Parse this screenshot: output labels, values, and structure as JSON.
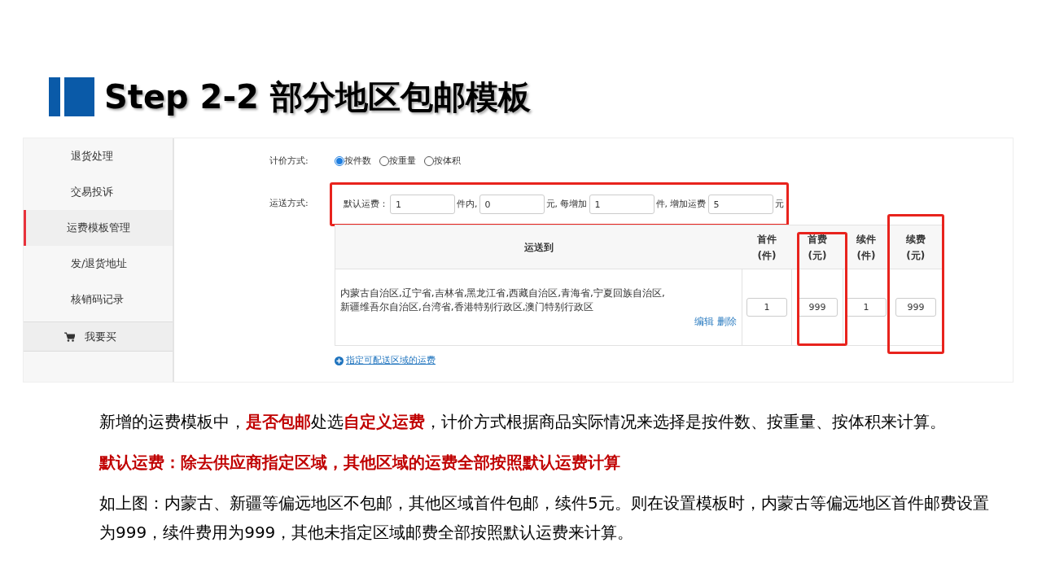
{
  "title": "Step 2-2 部分地区包邮模板",
  "sidebar": {
    "items": [
      {
        "label": "退货处理",
        "selected": false
      },
      {
        "label": "交易投诉",
        "selected": false
      },
      {
        "label": "运费模板管理",
        "selected": true
      },
      {
        "label": "发/退货地址",
        "selected": false
      },
      {
        "label": "核销码记录",
        "selected": false
      }
    ],
    "buy_button": "我要买"
  },
  "form": {
    "pricing_label": "计价方式:",
    "pricing_options": [
      {
        "label": "按件数",
        "selected": true
      },
      {
        "label": "按重量",
        "selected": false
      },
      {
        "label": "按体积",
        "selected": false
      }
    ],
    "shipping_label": "运送方式:",
    "default_fee": {
      "highlighted": true,
      "segments": [
        {
          "kind": "text",
          "text": "默认运费："
        },
        {
          "kind": "field",
          "value": "1"
        },
        {
          "kind": "text",
          "text": "件内,"
        },
        {
          "kind": "field",
          "value": "0"
        },
        {
          "kind": "text",
          "text": "元, 每增加"
        },
        {
          "kind": "field",
          "value": "1"
        },
        {
          "kind": "text",
          "text": "件, 增加运费"
        },
        {
          "kind": "field",
          "value": "5"
        },
        {
          "kind": "text",
          "text": "元"
        }
      ]
    }
  },
  "table": {
    "columns": [
      {
        "lines": [
          "运送到"
        ],
        "highlighted": false
      },
      {
        "lines": [
          "首件",
          "(件)"
        ],
        "highlighted": false
      },
      {
        "lines": [
          "首费",
          "(元)"
        ],
        "highlighted": true
      },
      {
        "lines": [
          "续件",
          "(件)"
        ],
        "highlighted": false
      },
      {
        "lines": [
          "续费",
          "(元)"
        ],
        "highlighted": true
      }
    ],
    "rows": [
      {
        "regions": "内蒙古自治区,辽宁省,吉林省,黑龙江省,西藏自治区,青海省,宁夏回族自治区,新疆维吾尔自治区,台湾省,香港特别行政区,澳门特别行政区",
        "actions": [
          "编辑",
          "删除"
        ],
        "values": [
          "1",
          "999",
          "1",
          "999"
        ]
      }
    ]
  },
  "add_link": "指定可配送区域的运费",
  "paragraphs": [
    {
      "kind": "normal",
      "text": "新增的运费模板中，**是否包邮**处选**自定义运费**，计价方式根据商品实际情况来选择是按件数、按重量、按体积来计算。"
    },
    {
      "kind": "emphasis",
      "text": "默认运费：除去供应商指定区域，其他区域的运费全部按照默认运费计算"
    },
    {
      "kind": "normal",
      "text": "如上图：内蒙古、新疆等偏远地区不包邮，其他区域首件包邮，续件5元。则在设置模板时，内蒙古等偏远地区首件邮费设置为999，续件费用为999，其他未指定区域邮费全部按照默认运费来计算。"
    }
  ]
}
